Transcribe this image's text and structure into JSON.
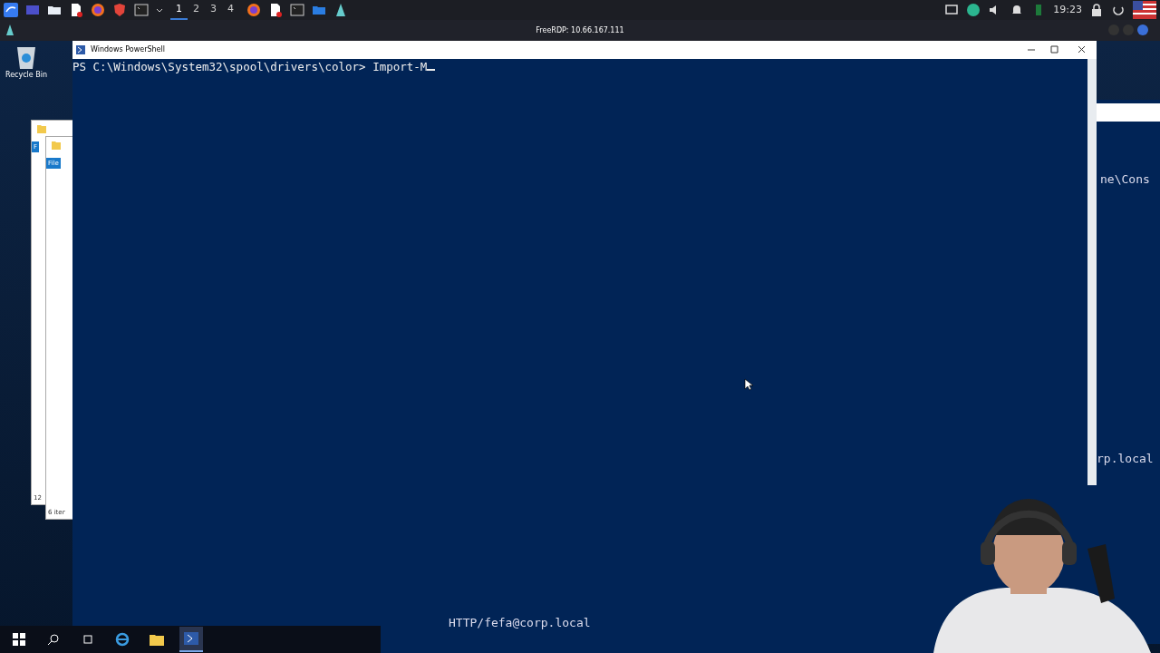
{
  "top_bar": {
    "workspaces": [
      {
        "label": "1",
        "selected": true
      },
      {
        "label": "2",
        "selected": false
      },
      {
        "label": "3",
        "selected": false
      },
      {
        "label": "4",
        "selected": false
      }
    ],
    "clock": "19:23"
  },
  "rdp_window": {
    "title": "FreeRDP: 10.66.167.111"
  },
  "desktop": {
    "icons": [
      {
        "label": "Recycle Bin"
      }
    ]
  },
  "explorer_windows": [
    {
      "tab": "F",
      "status": "12"
    },
    {
      "tab": "File",
      "status": "6 iter"
    }
  ],
  "background_console": {
    "lines": [
      "ne\\Cons",
      "rp.local"
    ],
    "bottom_line": "HTTP/fefa@corp.local"
  },
  "powershell": {
    "title": "Windows PowerShell",
    "prompt": "PS C:\\Windows\\System32\\spool\\drivers\\color> ",
    "input": "Import-M"
  }
}
